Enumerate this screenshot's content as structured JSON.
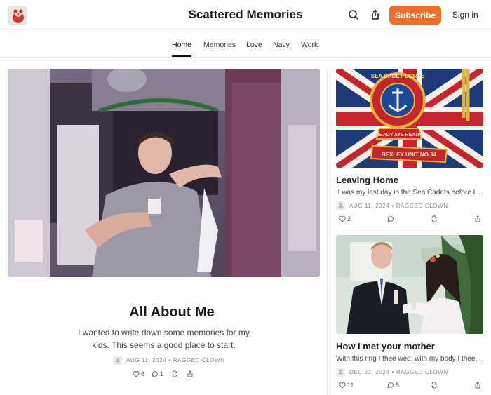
{
  "header": {
    "site_title": "Scattered Memories",
    "subscribe_label": "Subscribe",
    "signin_label": "Sign in",
    "icons": [
      "search-icon",
      "share-icon"
    ],
    "accent_color": "#ee6e2b"
  },
  "nav": {
    "items": [
      {
        "label": "Home",
        "active": true
      },
      {
        "label": "Memories"
      },
      {
        "label": "Love"
      },
      {
        "label": "Navy"
      },
      {
        "label": "Work"
      }
    ]
  },
  "hero": {
    "title": "All About Me",
    "subtitle": "I wanted to write down some memories for my kids. This seems a good place to start.",
    "date": "AUG 11, 2024",
    "author": "RAGGED CLOWN",
    "likes": "6",
    "comments": "1"
  },
  "cards": [
    {
      "title": "Leaving Home",
      "subtitle": "It was my last day in the Sea Cadets before I...",
      "date": "AUG 11, 2024",
      "author": "RAGGED CLOWN",
      "likes": "2",
      "comments": "",
      "image_text": {
        "badge_top": "SEA CADET CORPS",
        "motto": "READY AYE READY",
        "unit": "BEXLEY UNIT NO.34"
      }
    },
    {
      "title": "How I met your mother",
      "subtitle": "With this ring I thee wed; with my body I thee...",
      "date": "DEC 23, 2024",
      "author": "RAGGED CLOWN",
      "likes": "11",
      "comments": "5"
    }
  ]
}
